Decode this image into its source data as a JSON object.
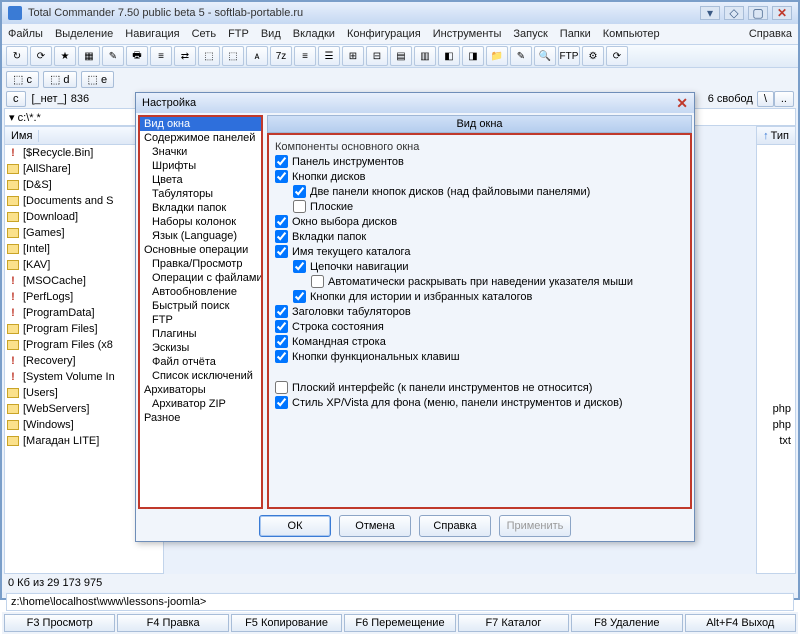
{
  "title": "Total Commander 7.50 public beta 5 - softlab-portable.ru",
  "menubar": [
    "Файлы",
    "Выделение",
    "Навигация",
    "Сеть",
    "FTP",
    "Вид",
    "Вкладки",
    "Конфигурация",
    "Инструменты",
    "Запуск",
    "Папки",
    "Компьютер"
  ],
  "menu_help": "Справка",
  "drives": [
    "c",
    "d",
    "e"
  ],
  "curdrive_label": "c",
  "nolabel": "[_нет_]",
  "size_left": "836",
  "freespace_right": "6 свобод",
  "path": "▾ c:\\*.*",
  "col_name": "Имя",
  "col_type": "Тип",
  "files": [
    {
      "icon": "excl",
      "name": "[$Recycle.Bin]"
    },
    {
      "icon": "fld",
      "name": "[AllShare]"
    },
    {
      "icon": "fld",
      "name": "[D&S]"
    },
    {
      "icon": "fld",
      "name": "[Documents and S"
    },
    {
      "icon": "fld",
      "name": "[Download]"
    },
    {
      "icon": "fld",
      "name": "[Games]"
    },
    {
      "icon": "fld",
      "name": "[Intel]"
    },
    {
      "icon": "fld",
      "name": "[KAV]"
    },
    {
      "icon": "excl",
      "name": "[MSOCache]"
    },
    {
      "icon": "excl",
      "name": "[PerfLogs]"
    },
    {
      "icon": "excl",
      "name": "[ProgramData]"
    },
    {
      "icon": "fld",
      "name": "[Program Files]"
    },
    {
      "icon": "fld",
      "name": "[Program Files (x8"
    },
    {
      "icon": "excl",
      "name": "[Recovery]"
    },
    {
      "icon": "excl",
      "name": "[System Volume In"
    },
    {
      "icon": "fld",
      "name": "[Users]"
    },
    {
      "icon": "fld",
      "name": "[WebServers]"
    },
    {
      "icon": "fld",
      "name": "[Windows]"
    },
    {
      "icon": "fld",
      "name": "[Магадан LITE]"
    }
  ],
  "right_types": [
    "",
    "",
    "",
    "",
    "",
    "",
    "",
    "",
    "",
    "",
    "",
    "",
    "",
    "",
    "",
    "",
    "php",
    "php",
    "txt"
  ],
  "status": "0 Кб из 29 173 975",
  "cmdline": "z:\\home\\localhost\\www\\lessons-joomla>",
  "fkeys": [
    "F3 Просмотр",
    "F4 Правка",
    "F5 Копирование",
    "F6 Перемещение",
    "F7 Каталог",
    "F8 Удаление",
    "Alt+F4 Выход"
  ],
  "dialog": {
    "title": "Настройка",
    "pane_title": "Вид окна",
    "tree": [
      {
        "t": "Вид окна",
        "sel": true
      },
      {
        "t": "Содержимое панелей"
      },
      {
        "t": "Значки",
        "sub": true
      },
      {
        "t": "Шрифты",
        "sub": true
      },
      {
        "t": "Цвета",
        "sub": true
      },
      {
        "t": "Табуляторы",
        "sub": true
      },
      {
        "t": "Вкладки папок",
        "sub": true
      },
      {
        "t": "Наборы колонок",
        "sub": true
      },
      {
        "t": "Язык (Language)",
        "sub": true
      },
      {
        "t": "Основные операции"
      },
      {
        "t": "Правка/Просмотр",
        "sub": true
      },
      {
        "t": "Операции с файлами",
        "sub": true
      },
      {
        "t": "Автообновление",
        "sub": true
      },
      {
        "t": "Быстрый поиск",
        "sub": true
      },
      {
        "t": "FTP",
        "sub": true
      },
      {
        "t": "Плагины",
        "sub": true
      },
      {
        "t": "Эскизы",
        "sub": true
      },
      {
        "t": "Файл отчёта",
        "sub": true
      },
      {
        "t": "Список исключений",
        "sub": true
      },
      {
        "t": "Архиваторы"
      },
      {
        "t": "Архиватор ZIP",
        "sub": true
      },
      {
        "t": "Разное"
      }
    ],
    "section1": "Компоненты основного окна",
    "checks": [
      {
        "l": "Панель инструментов",
        "c": true
      },
      {
        "l": "Кнопки дисков",
        "c": true
      },
      {
        "l": "Две панели кнопок дисков (над файловыми панелями)",
        "c": true,
        "sub": true
      },
      {
        "l": "Плоские",
        "c": false,
        "sub": true
      },
      {
        "l": "Окно выбора дисков",
        "c": true
      },
      {
        "l": "Вкладки папок",
        "c": true
      },
      {
        "l": "Имя текущего каталога",
        "c": true
      },
      {
        "l": "Цепочки навигации",
        "c": true,
        "sub": true
      },
      {
        "l": "Автоматически раскрывать при наведении указателя мыши",
        "c": false,
        "sub2": true
      },
      {
        "l": "Кнопки для истории и избранных каталогов",
        "c": true,
        "sub": true
      },
      {
        "l": "Заголовки табуляторов",
        "c": true
      },
      {
        "l": "Строка состояния",
        "c": true
      },
      {
        "l": "Командная строка",
        "c": true
      },
      {
        "l": "Кнопки функциональных клавиш",
        "c": true
      }
    ],
    "checks2": [
      {
        "l": "Плоский интерфейс (к панели инструментов не относится)",
        "c": false
      },
      {
        "l": "Стиль XP/Vista для фона (меню, панели инструментов и дисков)",
        "c": true
      }
    ],
    "btn_ok": "ОК",
    "btn_cancel": "Отмена",
    "btn_help": "Справка",
    "btn_apply": "Применить"
  }
}
